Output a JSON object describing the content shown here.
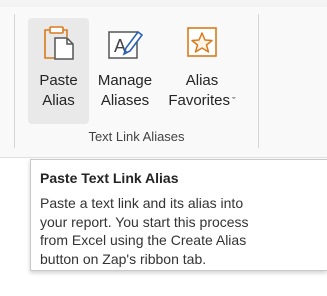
{
  "ribbon": {
    "group_label": "Text Link Aliases",
    "buttons": [
      {
        "line1": "Paste",
        "line2": "Alias",
        "icon": "paste-alias-icon"
      },
      {
        "line1": "Manage",
        "line2": "Aliases",
        "icon": "manage-aliases-icon"
      },
      {
        "line1": "Alias",
        "line2": "Favorites",
        "icon": "alias-favorites-icon",
        "dropdown": "ˇ"
      }
    ]
  },
  "tooltip": {
    "title": "Paste Text Link Alias",
    "body_lines": [
      "Paste a text link and its alias into",
      "your report. You start this process",
      "from Excel using the Create Alias",
      "button on Zap's ribbon tab."
    ]
  },
  "colors": {
    "accent_orange": "#d97b1c",
    "icon_blue": "#2c62b7",
    "ribbon_bg": "#f9f9f9",
    "hover_bg": "#e9e9e9"
  }
}
